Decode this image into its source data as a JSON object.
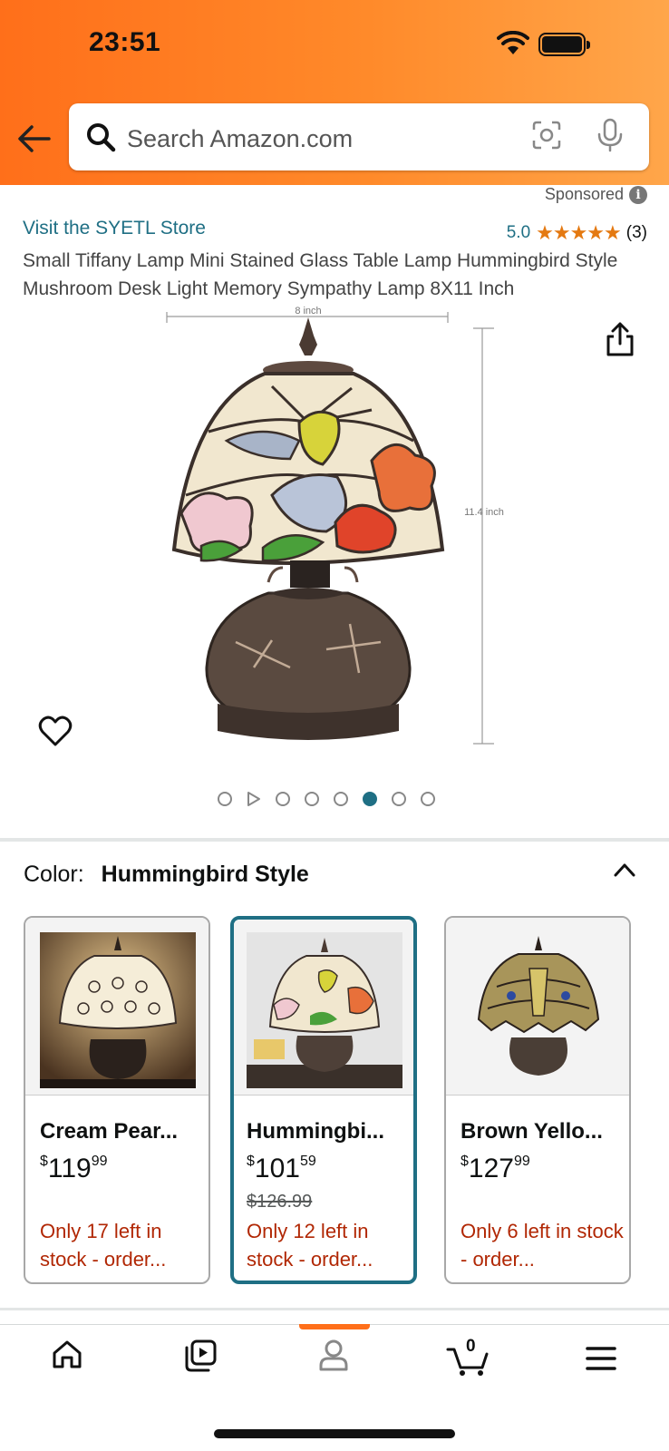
{
  "status_bar": {
    "time": "23:51"
  },
  "search": {
    "placeholder": "Search Amazon.com"
  },
  "ad": {
    "sponsored_label": "Sponsored",
    "info_symbol": "i"
  },
  "product": {
    "store_link": "Visit the SYETL Store",
    "rating_value": "5.0",
    "rating_stars": 5,
    "rating_count": "(3)",
    "title": "Small Tiffany Lamp Mini Stained Glass Table Lamp Hummingbird Style Mushroom Desk Light Memory Sympathy Lamp 8X11 Inch",
    "dimension_width": "8 inch",
    "dimension_height": "11.4 inch"
  },
  "gallery": {
    "total_items": 8,
    "active_index": 5,
    "video_index": 1
  },
  "color": {
    "label": "Color:",
    "selected": "Hummingbird Style",
    "variants": [
      {
        "name": "Cream Pear...",
        "price_currency": "$",
        "price_whole": "119",
        "price_fraction": "99",
        "was_price": "",
        "stock": "Only 17 left in stock - order..."
      },
      {
        "name": "Hummingbi...",
        "price_currency": "$",
        "price_whole": "101",
        "price_fraction": "59",
        "was_price": "$126.99",
        "stock": "Only 12 left in stock - order..."
      },
      {
        "name": "Brown Yello...",
        "price_currency": "$",
        "price_whole": "127",
        "price_fraction": "99",
        "was_price": "",
        "stock": "Only 6 left in stock - order..."
      }
    ]
  },
  "tabbar": {
    "cart_count": "0",
    "active_tab": "profile"
  },
  "colors": {
    "accent_orange": "#ff6f1a",
    "link_teal": "#1f6f84",
    "star_orange": "#e47911",
    "stock_red": "#b12704"
  }
}
